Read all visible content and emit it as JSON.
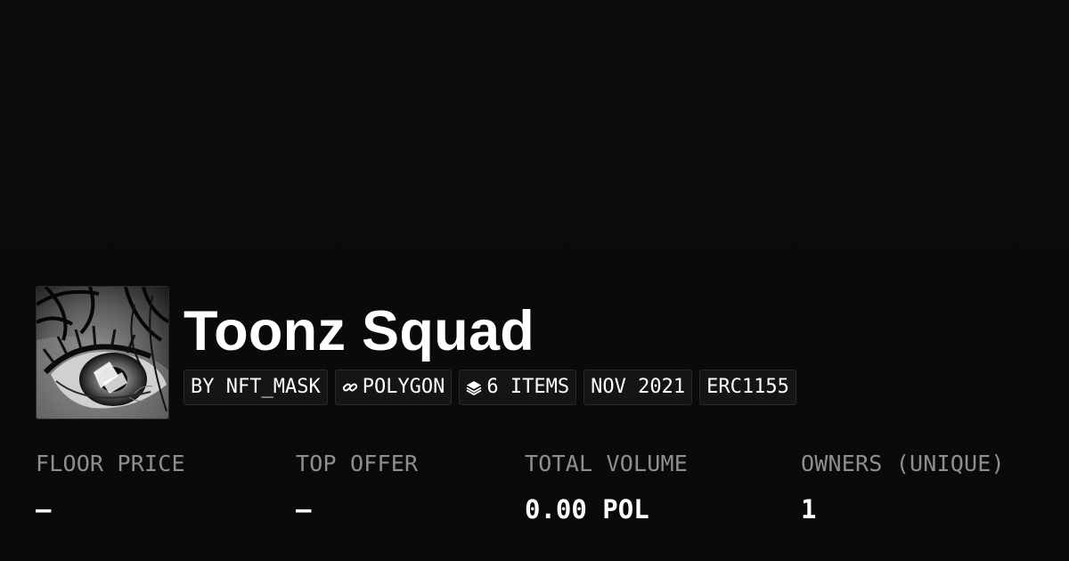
{
  "collection": {
    "title": "Toonz Squad",
    "avatar_icon": "anime-eye-image"
  },
  "chips": {
    "creator": "BY NFT_MASK",
    "chain": "POLYGON",
    "chain_icon": "link-icon",
    "items": "6 ITEMS",
    "items_icon": "layers-icon",
    "date": "NOV 2021",
    "standard": "ERC1155"
  },
  "stats": [
    {
      "label": "FLOOR PRICE",
      "value": "—"
    },
    {
      "label": "TOP OFFER",
      "value": "—"
    },
    {
      "label": "TOTAL VOLUME",
      "value": "0.00 POL"
    },
    {
      "label": "OWNERS (UNIQUE)",
      "value": "1"
    }
  ],
  "colors": {
    "background": "#0b0b0b",
    "chip_background": "#151515",
    "label_gray": "#8f8f8f",
    "text": "#ffffff"
  }
}
